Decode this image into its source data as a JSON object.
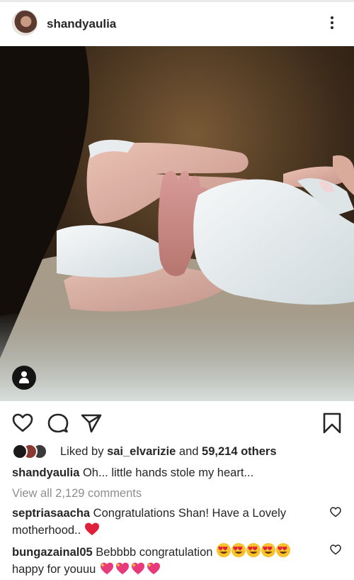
{
  "post": {
    "username": "shandyaulia"
  },
  "likes": {
    "prefix": "Liked by",
    "user": "sai_elvarizie",
    "middle": "and",
    "count": "59,214 others"
  },
  "caption": {
    "username": "shandyaulia",
    "text": "Oh... little hands stole my heart..."
  },
  "view_all": "View all 2,129 comments",
  "comments": [
    {
      "username": "septriasaacha",
      "text": "Congratulations Shan! Have a Lovely motherhood..",
      "emojis": [
        "red-heart"
      ]
    },
    {
      "username": "bungazainal05",
      "text": "Bebbbb congratulation",
      "emojis_after_text": [
        "heart-eyes",
        "heart-eyes",
        "heart-eyes",
        "heart-eyes",
        "heart-eyes"
      ],
      "line2": "happy for youuu",
      "emojis_line2": [
        "sparkling-heart",
        "sparkling-heart",
        "sparkling-heart",
        "sparkling-heart"
      ]
    }
  ],
  "icons": {
    "more": "more-vertical-icon",
    "like": "heart-outline-icon",
    "comment": "comment-bubble-icon",
    "share": "paper-plane-icon",
    "save": "bookmark-icon",
    "tag": "user-tag-icon"
  },
  "colors": {
    "text": "#262626",
    "muted": "#8e8e8e",
    "heart_red": "#e0203a",
    "emoji_yellow": "#f7c22b",
    "emoji_pink": "#e8397a"
  }
}
